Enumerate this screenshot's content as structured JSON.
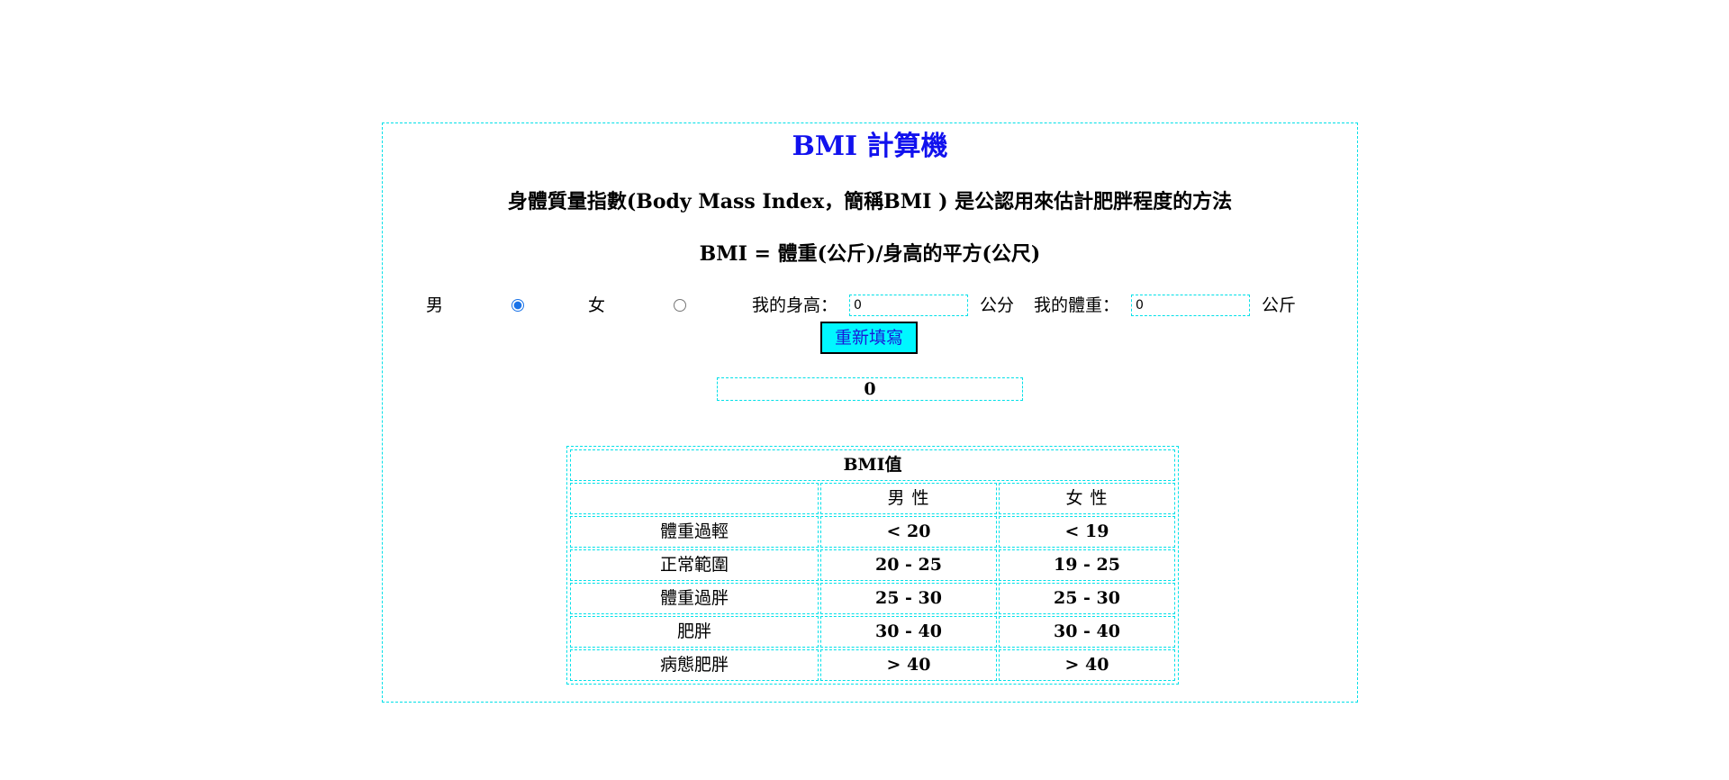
{
  "title": "BMI 計算機",
  "description": "身體質量指數(Body Mass Index，簡稱BMI ) 是公認用來估計肥胖程度的方法",
  "formula": "BMI = 體重(公斤)/身高的平方(公尺)",
  "form": {
    "male_label": "男",
    "female_label": "女",
    "selected_gender": "male",
    "height_label": "我的身高：",
    "height_value": "0",
    "height_unit": "公分",
    "weight_label": "我的體重：",
    "weight_value": "0",
    "weight_unit": "公斤",
    "reset_label": "重新填寫"
  },
  "result": "0",
  "table": {
    "caption": "BMI值",
    "headers": [
      "",
      "男 性",
      "女 性"
    ],
    "rows": [
      {
        "category": "體重過輕",
        "male": "< 20",
        "female": "< 19"
      },
      {
        "category": "正常範圍",
        "male": "20 - 25",
        "female": "19 - 25"
      },
      {
        "category": "體重過胖",
        "male": "25 - 30",
        "female": "25 - 30"
      },
      {
        "category": "肥胖",
        "male": "30 - 40",
        "female": "30 - 40"
      },
      {
        "category": "病態肥胖",
        "male": "> 40",
        "female": "> 40"
      }
    ]
  },
  "colors": {
    "title": "#1111ee",
    "border": "#00e0e8",
    "button_bg": "#00f7ff",
    "button_text": "#1a1ad8",
    "radio_checked": "#1a73e8"
  }
}
